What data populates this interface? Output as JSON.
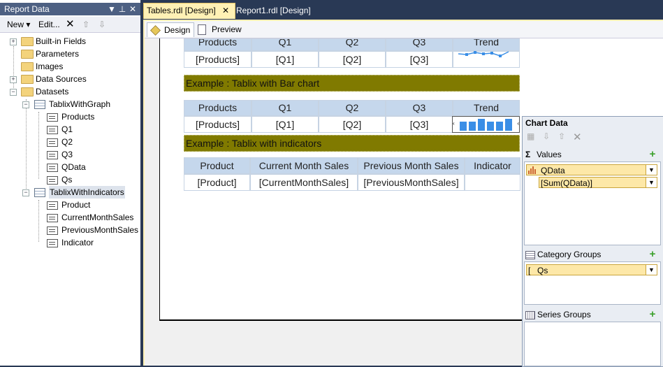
{
  "report_data": {
    "title": "Report Data",
    "pin_glyph": "▼",
    "pin2_glyph": "⊥",
    "close_glyph": "✕",
    "toolbar": {
      "new_label": "New ▾",
      "edit_label": "Edit...",
      "delete_glyph": "✕",
      "up_glyph": "⇧",
      "down_glyph": "⇩"
    },
    "tree": {
      "builtin": "Built-in Fields",
      "parameters": "Parameters",
      "images": "Images",
      "data_sources": "Data Sources",
      "datasets": "Datasets",
      "tablix_graph": "TablixWithGraph",
      "graph_fields": [
        "Products",
        "Q1",
        "Q2",
        "Q3",
        "QData",
        "Qs"
      ],
      "tablix_indicators": "TablixWithIndicators",
      "indicator_fields": [
        "Product",
        "CurrentMonthSales",
        "PreviousMonthSales",
        "Indicator"
      ]
    }
  },
  "tabs": {
    "active": "Tables.rdl [Design]",
    "active_close": "✕",
    "inactive": "Report1.rdl [Design]"
  },
  "subtabs": {
    "design": "Design",
    "preview": "Preview"
  },
  "table1": {
    "headers": [
      "Products",
      "Q1",
      "Q2",
      "Q3",
      "Trend"
    ],
    "row": [
      "[Products]",
      "[Q1]",
      "[Q2]",
      "[Q3]"
    ]
  },
  "banner_bar": "Example : Tablix with Bar chart",
  "table2": {
    "headers": [
      "Products",
      "Q1",
      "Q2",
      "Q3",
      "Trend"
    ],
    "row": [
      "[Products]",
      "[Q1]",
      "[Q2]",
      "[Q3]"
    ]
  },
  "banner_indicators": "Example : Tablix with indicators",
  "table3": {
    "headers": [
      "Product",
      "Current Month Sales",
      "Previous Month Sales",
      "Indicator"
    ],
    "row": [
      "[Product]",
      "[CurrentMonthSales]",
      "[PreviousMonthSales]",
      ""
    ]
  },
  "chart_data_pane": {
    "title": "Chart Data",
    "values_label": "Values",
    "values_glyph": "Σ",
    "value_series": "QData",
    "value_expr": "[Sum(QData)]",
    "category_label": "Category Groups",
    "category_value": "Qs",
    "series_label": "Series Groups",
    "plus_glyph": "+",
    "arrow_glyph": "▼",
    "toolbar_up": "⇧",
    "toolbar_down": "⇩",
    "toolbar_delete": "✕"
  },
  "colors": {
    "accent_bar": "#3a8ee6",
    "banner": "#807a00",
    "header": "#c5d7ec"
  }
}
